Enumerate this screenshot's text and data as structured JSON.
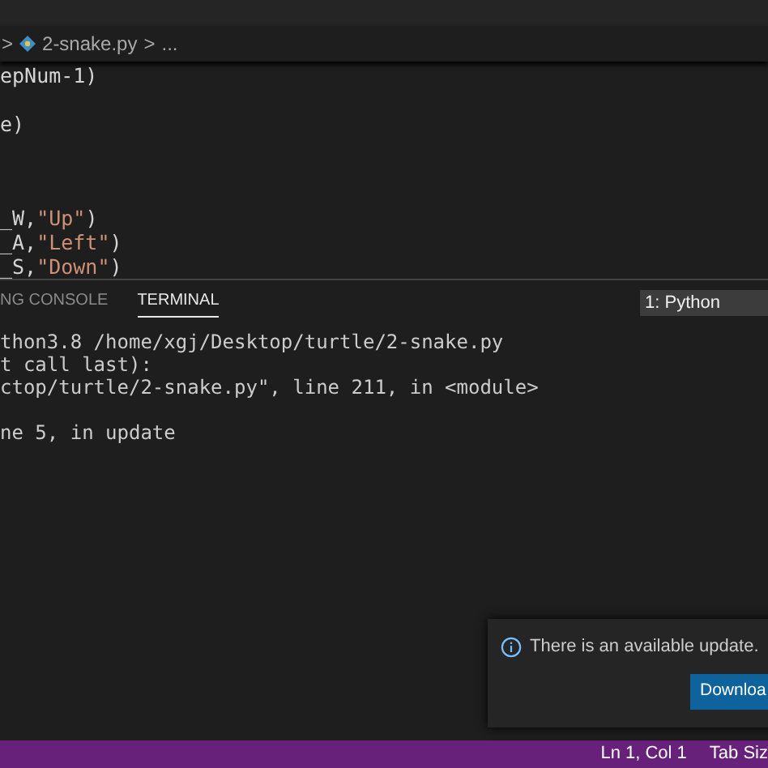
{
  "breadcrumb": {
    "chevron": ">",
    "file": "2-snake.py",
    "separator": ">",
    "more": "..."
  },
  "editor": {
    "lines": [
      {
        "kind": "code",
        "tokens": [
          {
            "kind": "plain",
            "text": "epNum-1)"
          }
        ]
      },
      {
        "kind": "blank"
      },
      {
        "kind": "code",
        "tokens": [
          {
            "kind": "plain",
            "text": "e)"
          }
        ]
      },
      {
        "kind": "blank"
      },
      {
        "kind": "blank"
      },
      {
        "kind": "blank"
      },
      {
        "kind": "code",
        "tokens": [
          {
            "kind": "plain",
            "text": "_W,"
          },
          {
            "kind": "string",
            "text": "\"Up\""
          },
          {
            "kind": "plain",
            "text": ")"
          }
        ]
      },
      {
        "kind": "code",
        "tokens": [
          {
            "kind": "plain",
            "text": "_A,"
          },
          {
            "kind": "string",
            "text": "\"Left\""
          },
          {
            "kind": "plain",
            "text": ")"
          }
        ]
      },
      {
        "kind": "code",
        "tokens": [
          {
            "kind": "plain",
            "text": "_S,"
          },
          {
            "kind": "string",
            "text": "\"Down\""
          },
          {
            "kind": "plain",
            "text": ")"
          }
        ]
      }
    ]
  },
  "panel": {
    "tabs": [
      {
        "label": "NG CONSOLE",
        "selected": false
      },
      {
        "label": "TERMINAL",
        "selected": true
      }
    ],
    "terminal_select": "1: Python",
    "terminal_lines": [
      {
        "kind": "text",
        "text": "thon3.8 /home/xgj/Desktop/turtle/2-snake.py"
      },
      {
        "kind": "text",
        "text": "t call last):"
      },
      {
        "kind": "text",
        "text": "ctop/turtle/2-snake.py\", line 211, in <module>"
      },
      {
        "kind": "blank"
      },
      {
        "kind": "text",
        "text": "ne 5, in update"
      }
    ]
  },
  "notification": {
    "message": "There is an available update.",
    "button": "Downloa"
  },
  "status_bar": {
    "items": [
      "Ln 1, Col 1",
      "Tab Siz"
    ]
  }
}
